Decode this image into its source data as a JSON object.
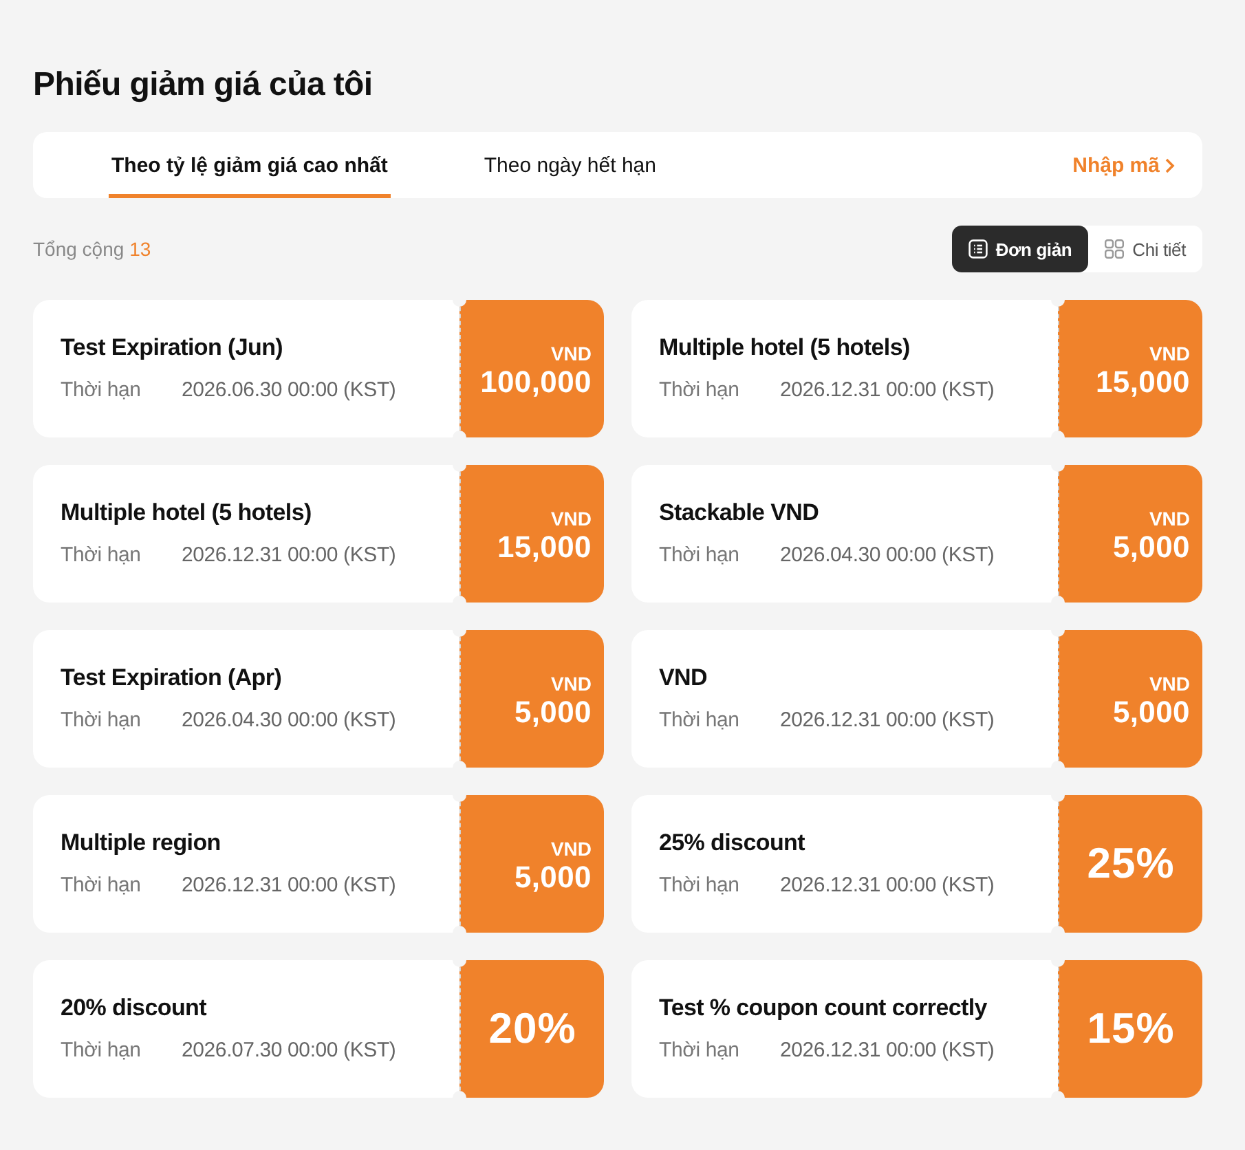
{
  "page": {
    "title": "Phiếu giảm giá của tôi"
  },
  "tabs": [
    {
      "label": "Theo tỷ lệ giảm giá cao nhất",
      "selected": true
    },
    {
      "label": "Theo ngày hết hạn",
      "selected": false
    }
  ],
  "enter_code": {
    "label": "Nhập mã"
  },
  "total": {
    "label": "Tổng cộng",
    "count": "13"
  },
  "view_modes": [
    {
      "label": "Đơn giản",
      "kind": "list",
      "selected": true
    },
    {
      "label": "Chi tiết",
      "kind": "grid",
      "selected": false
    }
  ],
  "coupons": [
    {
      "title": "Test Expiration (Jun)",
      "validity_label": "Thời hạn",
      "expiry": "2026.06.30 00:00 (KST)",
      "kind": "amount",
      "currency": "VND",
      "value": "100,000"
    },
    {
      "title": "Multiple hotel (5 hotels)",
      "validity_label": "Thời hạn",
      "expiry": "2026.12.31 00:00 (KST)",
      "kind": "amount",
      "currency": "VND",
      "value": "15,000"
    },
    {
      "title": "Multiple hotel (5 hotels)",
      "validity_label": "Thời hạn",
      "expiry": "2026.12.31 00:00 (KST)",
      "kind": "amount",
      "currency": "VND",
      "value": "15,000"
    },
    {
      "title": "Stackable VND",
      "validity_label": "Thời hạn",
      "expiry": "2026.04.30 00:00 (KST)",
      "kind": "amount",
      "currency": "VND",
      "value": "5,000"
    },
    {
      "title": "Test Expiration (Apr)",
      "validity_label": "Thời hạn",
      "expiry": "2026.04.30 00:00 (KST)",
      "kind": "amount",
      "currency": "VND",
      "value": "5,000"
    },
    {
      "title": "VND",
      "validity_label": "Thời hạn",
      "expiry": "2026.12.31 00:00 (KST)",
      "kind": "amount",
      "currency": "VND",
      "value": "5,000"
    },
    {
      "title": "Multiple region",
      "validity_label": "Thời hạn",
      "expiry": "2026.12.31 00:00 (KST)",
      "kind": "amount",
      "currency": "VND",
      "value": "5,000"
    },
    {
      "title": "25% discount",
      "validity_label": "Thời hạn",
      "expiry": "2026.12.31 00:00 (KST)",
      "kind": "percent",
      "value": "25%"
    },
    {
      "title": "20% discount",
      "validity_label": "Thời hạn",
      "expiry": "2026.07.30 00:00 (KST)",
      "kind": "percent",
      "value": "20%"
    },
    {
      "title": "Test % coupon count correctly",
      "validity_label": "Thời hạn",
      "expiry": "2026.12.31 00:00 (KST)",
      "kind": "percent",
      "value": "15%"
    }
  ]
}
